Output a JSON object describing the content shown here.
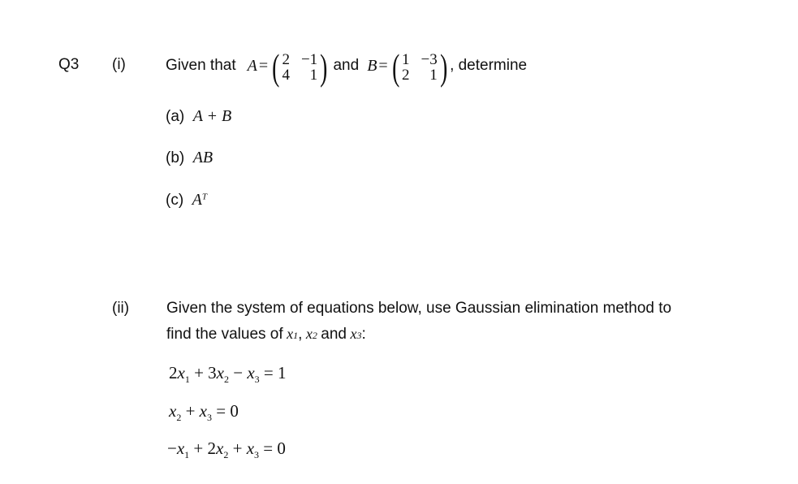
{
  "question": {
    "number": "Q3",
    "part_i": {
      "label": "(i)",
      "intro": "Given that",
      "matrix_A": {
        "name": "A",
        "rows": [
          [
            "2",
            "−1"
          ],
          [
            "4",
            "1"
          ]
        ]
      },
      "conjunction": "and",
      "matrix_B": {
        "name": "B",
        "rows": [
          [
            "1",
            "−3"
          ],
          [
            "2",
            "1"
          ]
        ]
      },
      "outro": ", determine",
      "subparts": [
        {
          "label": "(a)",
          "expression": "A + B"
        },
        {
          "label": "(b)",
          "expression": "AB"
        },
        {
          "label": "(c)",
          "expression": "A",
          "superscript": "T"
        }
      ]
    },
    "part_ii": {
      "label": "(ii)",
      "line1": "Given the system of equations below, use Gaussian elimination method to",
      "line2_prefix": "find the values of",
      "vars": [
        "x1",
        "x2",
        "x3"
      ],
      "line2_and": "and",
      "equations": [
        "2x₁ + 3x₂ − x₃ = 1",
        "x₂ + x₃ = 0",
        "−x₁ + 2x₂ + x₃ = 0"
      ]
    }
  }
}
